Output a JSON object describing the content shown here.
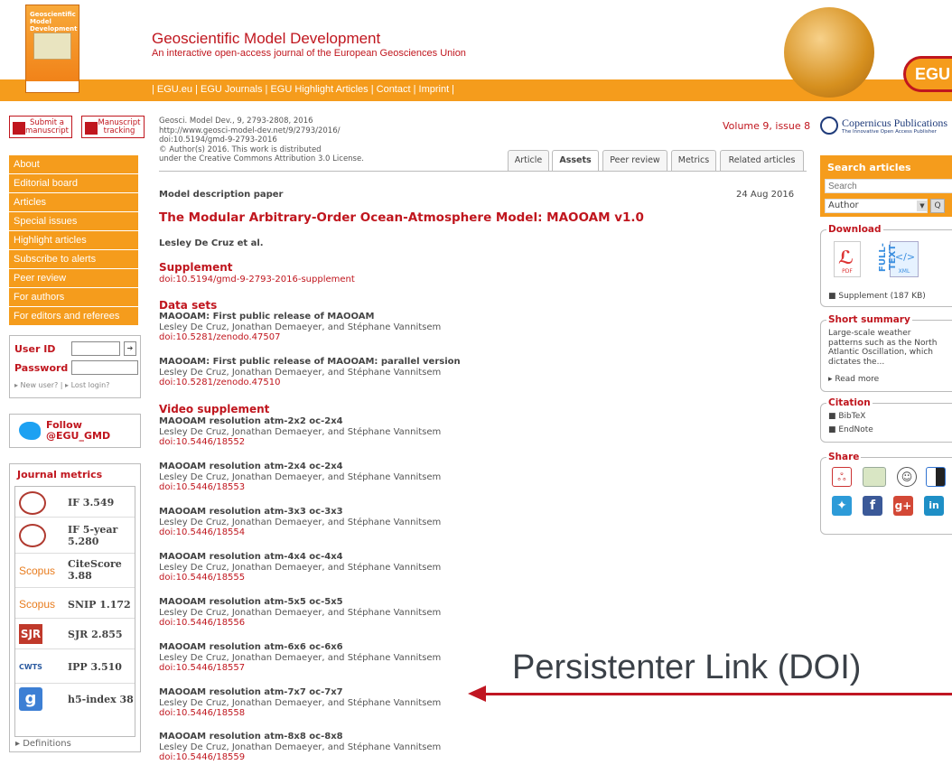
{
  "header": {
    "cover_title": "Geoscientific Model Development",
    "title": "Geoscientific Model Development",
    "subtitle": "An interactive open-access journal of the European Geosciences Union",
    "logo_text": "EGU",
    "nav": "| EGU.eu | EGU Journals | EGU Highlight Articles | Contact | Imprint |"
  },
  "sidebar": {
    "submit_label": "Submit a manuscript",
    "tracking_label": "Manuscript tracking",
    "nav": [
      "About",
      "Editorial board",
      "Articles",
      "Special issues",
      "Highlight articles",
      "Subscribe to alerts",
      "Peer review",
      "For authors",
      "For editors and referees"
    ],
    "login": {
      "user_id_label": "User ID",
      "password_label": "Password",
      "links": "▸ New user? | ▸ Lost login?"
    },
    "twitter": {
      "line1": "Follow",
      "line2": "@EGU_GMD"
    },
    "metrics": {
      "title": "Journal metrics",
      "items": [
        {
          "icon": "impact-factor-badge-icon",
          "value": "IF 3.549"
        },
        {
          "icon": "impact-factor-badge-icon",
          "value": "IF 5-year 5.280"
        },
        {
          "icon": "scopus-logo-icon",
          "logo_text": "Scopus",
          "value": "CiteScore 3.88"
        },
        {
          "icon": "scopus-logo-icon",
          "logo_text": "Scopus",
          "value": "SNIP 1.172"
        },
        {
          "icon": "sjr-logo-icon",
          "logo_text": "SJR",
          "value": "SJR 2.855"
        },
        {
          "icon": "cwts-logo-icon",
          "logo_text": "CWTS",
          "value": "IPP 3.510"
        },
        {
          "icon": "google-scholar-icon",
          "logo_text": "g",
          "value": "h5-index 38"
        }
      ],
      "definitions": "▸ Definitions"
    }
  },
  "article": {
    "meta_lines": [
      "Geosci. Model Dev., 9, 2793-2808, 2016",
      "http://www.geosci-model-dev.net/9/2793/2016/",
      "doi:10.5194/gmd-9-2793-2016",
      "© Author(s) 2016. This work is distributed",
      "under the Creative Commons Attribution 3.0 License."
    ],
    "volume": "Volume 9, issue 8",
    "tabs": [
      "Article",
      "Assets",
      "Peer review",
      "Metrics",
      "Related articles"
    ],
    "active_tab": "Assets",
    "type": "Model description paper",
    "date": "24 Aug 2016",
    "title": "The Modular Arbitrary-Order Ocean-Atmosphere Model: MAOOAM v1.0",
    "authors": "Lesley De Cruz et al.",
    "supplement": {
      "heading": "Supplement",
      "doi": "doi:10.5194/gmd-9-2793-2016-supplement"
    },
    "datasets": {
      "heading": "Data sets",
      "items": [
        {
          "title": "MAOOAM: First public release of MAOOAM",
          "authors": "Lesley De Cruz, Jonathan Demaeyer, and Stéphane Vannitsem",
          "doi": "doi:10.5281/zenodo.47507"
        },
        {
          "title": "MAOOAM: First public release of MAOOAM: parallel version",
          "authors": "Lesley De Cruz, Jonathan Demaeyer, and Stéphane Vannitsem",
          "doi": "doi:10.5281/zenodo.47510"
        }
      ]
    },
    "videos": {
      "heading": "Video supplement",
      "items": [
        {
          "title": "MAOOAM resolution atm-2x2 oc-2x4",
          "authors": "Lesley De Cruz, Jonathan Demaeyer, and Stéphane Vannitsem",
          "doi": "doi:10.5446/18552"
        },
        {
          "title": "MAOOAM resolution atm-2x4 oc-2x4",
          "authors": "Lesley De Cruz, Jonathan Demaeyer, and Stéphane Vannitsem",
          "doi": "doi:10.5446/18553"
        },
        {
          "title": "MAOOAM resolution atm-3x3 oc-3x3",
          "authors": "Lesley De Cruz, Jonathan Demaeyer, and Stéphane Vannitsem",
          "doi": "doi:10.5446/18554"
        },
        {
          "title": "MAOOAM resolution atm-4x4 oc-4x4",
          "authors": "Lesley De Cruz, Jonathan Demaeyer, and Stéphane Vannitsem",
          "doi": "doi:10.5446/18555"
        },
        {
          "title": "MAOOAM resolution atm-5x5 oc-5x5",
          "authors": "Lesley De Cruz, Jonathan Demaeyer, and Stéphane Vannitsem",
          "doi": "doi:10.5446/18556"
        },
        {
          "title": "MAOOAM resolution atm-6x6 oc-6x6",
          "authors": "Lesley De Cruz, Jonathan Demaeyer, and Stéphane Vannitsem",
          "doi": "doi:10.5446/18557"
        },
        {
          "title": "MAOOAM resolution atm-7x7 oc-7x7",
          "authors": "Lesley De Cruz, Jonathan Demaeyer, and Stéphane Vannitsem",
          "doi": "doi:10.5446/18558"
        },
        {
          "title": "MAOOAM resolution atm-8x8 oc-8x8",
          "authors": "Lesley De Cruz, Jonathan Demaeyer, and Stéphane Vannitsem",
          "doi": "doi:10.5446/18559"
        }
      ]
    }
  },
  "right": {
    "publisher_name": "Copernicus Publications",
    "publisher_sub": "The Innovative Open Access Publisher",
    "search": {
      "title": "Search articles",
      "placeholder": "Search",
      "field": "Author",
      "go": "Q"
    },
    "download": {
      "title": "Download",
      "pdf_label": "PDF",
      "fulltext_label": "FULL-TEXT",
      "xml_label": "XML",
      "supplement": "■ Supplement (187 KB)"
    },
    "summary": {
      "title": "Short summary",
      "text": "Large-scale weather patterns such as the North Atlantic Oscillation, which dictates the...",
      "read_more": "▸ Read more"
    },
    "citation": {
      "title": "Citation",
      "items": [
        "■ BibTeX",
        "■ EndNote"
      ]
    },
    "share": {
      "title": "Share",
      "icons": [
        "mendeley-icon",
        "citeulike-icon",
        "reddit-icon",
        "delicious-icon",
        "twitter-icon",
        "facebook-icon",
        "google-plus-icon",
        "linkedin-icon"
      ]
    }
  },
  "overlay": {
    "label": "Persistenter Link (DOI)"
  },
  "colors": {
    "accent": "#f59c1c",
    "brand_red": "#c0161e",
    "arrow": "#c01622"
  }
}
